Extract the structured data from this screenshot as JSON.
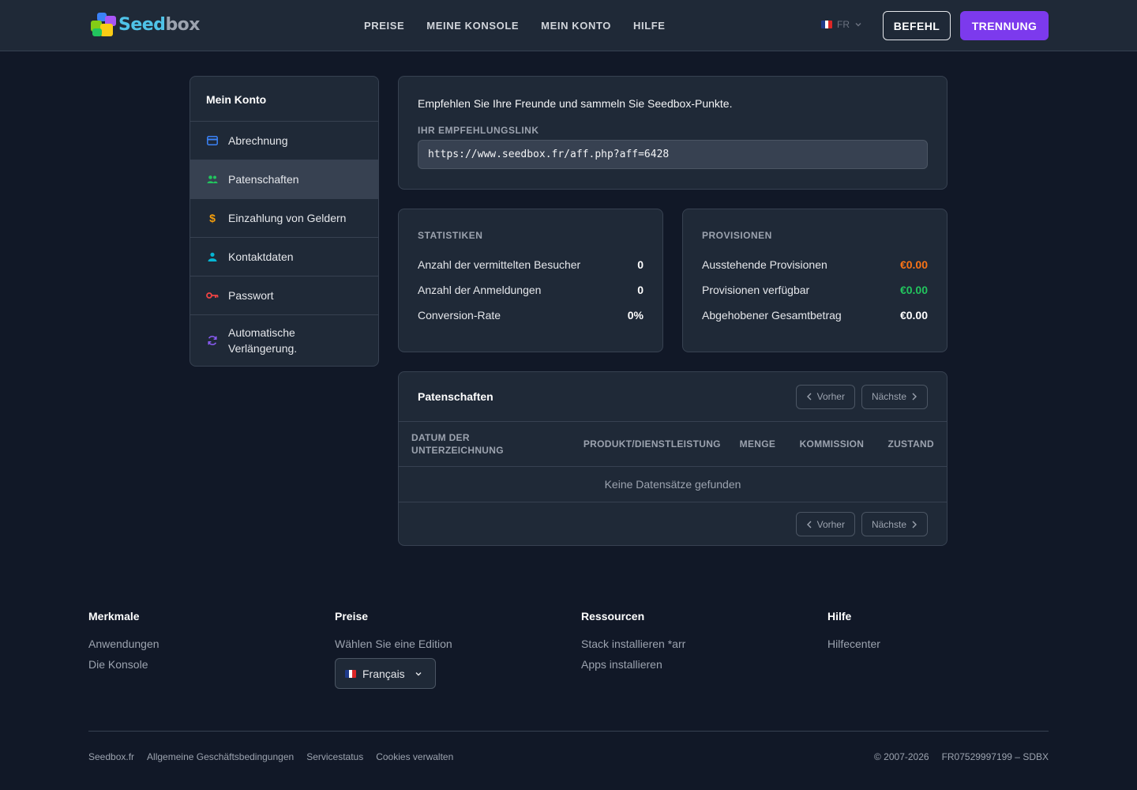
{
  "header": {
    "logo": {
      "text_part1": "Seed",
      "text_part2": "box"
    },
    "nav": [
      "PREISE",
      "MEINE KONSOLE",
      "MEIN KONTO",
      "HILFE"
    ],
    "language": "FR",
    "order_button": "BEFEHL",
    "logout_button": "TRENNUNG"
  },
  "sidebar": {
    "title": "Mein Konto",
    "items": [
      {
        "label": "Abrechnung",
        "icon": "credit-card-icon",
        "color": "#3b82f6"
      },
      {
        "label": "Patenschaften",
        "icon": "users-icon",
        "color": "#22c55e",
        "active": true
      },
      {
        "label": "Einzahlung von Geldern",
        "icon": "dollar-icon",
        "color": "#f59e0b"
      },
      {
        "label": "Kontaktdaten",
        "icon": "user-icon",
        "color": "#06b6d4"
      },
      {
        "label": "Passwort",
        "icon": "key-icon",
        "color": "#ef4444"
      },
      {
        "label": "Automatische Verlängerung.",
        "icon": "refresh-icon",
        "color": "#8b5cf6"
      }
    ]
  },
  "referral": {
    "description": "Empfehlen Sie Ihre Freunde und sammeln Sie Seedbox-Punkte.",
    "link_label": "IHR EMPFEHLUNGSLINK",
    "link_value": "https://www.seedbox.fr/aff.php?aff=6428"
  },
  "stats": {
    "title": "STATISTIKEN",
    "rows": [
      {
        "label": "Anzahl der vermittelten Besucher",
        "value": "0"
      },
      {
        "label": "Anzahl der Anmeldungen",
        "value": "0"
      },
      {
        "label": "Conversion-Rate",
        "value": "0%"
      }
    ]
  },
  "commissions": {
    "title": "PROVISIONEN",
    "rows": [
      {
        "label": "Ausstehende Provisionen",
        "value": "€0.00",
        "color": "#f97316"
      },
      {
        "label": "Provisionen verfügbar",
        "value": "€0.00",
        "color": "#22c55e"
      },
      {
        "label": "Abgehobener Gesamtbetrag",
        "value": "€0.00",
        "color": "#ffffff"
      }
    ]
  },
  "referrals_table": {
    "title": "Patenschaften",
    "prev": "Vorher",
    "next": "Nächste",
    "columns": [
      "DATUM DER UNTERZEICHNUNG",
      "PRODUKT/DIENSTLEISTUNG",
      "MENGE",
      "KOMMISSION",
      "ZUSTAND"
    ],
    "empty": "Keine Datensätze gefunden"
  },
  "footer": {
    "columns": [
      {
        "title": "Merkmale",
        "links": [
          "Anwendungen",
          "Die Konsole"
        ]
      },
      {
        "title": "Preise",
        "links": [
          "Wählen Sie eine Edition"
        ]
      },
      {
        "title": "Ressourcen",
        "links": [
          "Stack installieren *arr",
          "Apps installieren"
        ]
      },
      {
        "title": "Hilfe",
        "links": [
          "Hilfecenter"
        ]
      }
    ],
    "language_select": "Français",
    "bottom_links": [
      "Seedbox.fr",
      "Allgemeine Geschäftsbedingungen",
      "Servicestatus",
      "Cookies verwalten"
    ],
    "copyright": "© 2007-2026",
    "company_id": "FR07529997199 – SDBX"
  },
  "colors": {
    "accent": "#7c3aed",
    "background": "#111827",
    "surface": "#1f2937"
  }
}
